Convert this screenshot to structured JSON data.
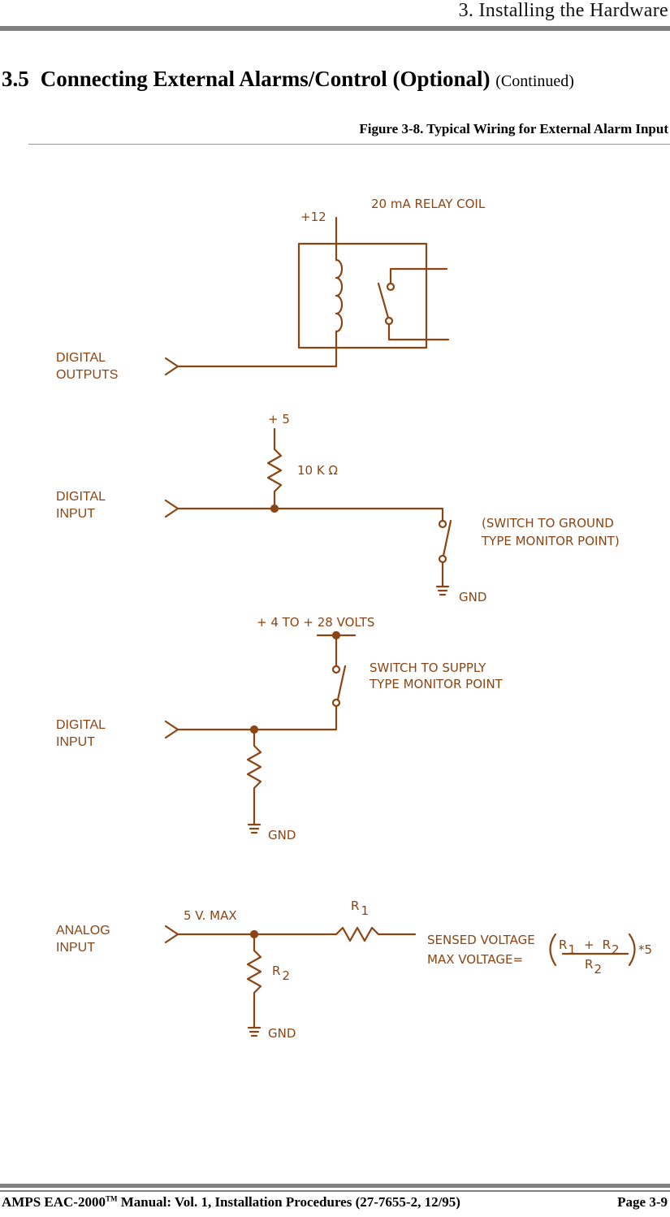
{
  "header": {
    "chapter": "3.  Installing the Hardware"
  },
  "section": {
    "number": "3.5",
    "title": "Connecting External Alarms/Control (Optional)",
    "continued": "(Continued)"
  },
  "figure": {
    "caption": "Figure 3-8.  Typical Wiring for External Alarm Input"
  },
  "colors": {
    "wire": "#8b4513"
  },
  "diagram": {
    "relay": {
      "side_label_line1": "DIGITAL",
      "side_label_line2": "OUTPUTS",
      "supply": "+12",
      "title": "20  mA  RELAY  COIL"
    },
    "ground_switch": {
      "side_label_line1": "DIGITAL",
      "side_label_line2": "INPUT",
      "supply": "+  5",
      "resistor": "10  K  Ω",
      "note_line1": "(SWITCH  TO  GROUND",
      "note_line2": "TYPE  MONITOR  POINT)",
      "ground": "GND"
    },
    "supply_switch": {
      "side_label_line1": "DIGITAL",
      "side_label_line2": "INPUT",
      "supply": "+  4  TO  +  28  VOLTS",
      "note_line1": "SWITCH  TO  SUPPLY",
      "note_line2": "TYPE  MONITOR  POINT",
      "ground": "GND"
    },
    "analog": {
      "side_label_line1": "ANALOG",
      "side_label_line2": "INPUT",
      "max": "5  V.  MAX",
      "r1": "R",
      "r1_sub": "1",
      "r2": "R",
      "r2_sub": "2",
      "sensed": "SENSED  VOLTAGE",
      "formula_prefix": "MAX  VOLTAGE=",
      "formula_num_r1": "R",
      "formula_num_r1_sub": "1",
      "formula_plus": "+",
      "formula_num_r2": "R",
      "formula_num_r2_sub": "2",
      "formula_den": "R",
      "formula_den_sub": "2",
      "formula_mult": "*5",
      "ground": "GND"
    }
  },
  "footer": {
    "manual": "AMPS EAC-2000",
    "tm": "TM",
    "rest": " Manual:  Vol. 1, Installation Procedures (27-7655-2, 12/95)",
    "page": "Page 3-9"
  }
}
